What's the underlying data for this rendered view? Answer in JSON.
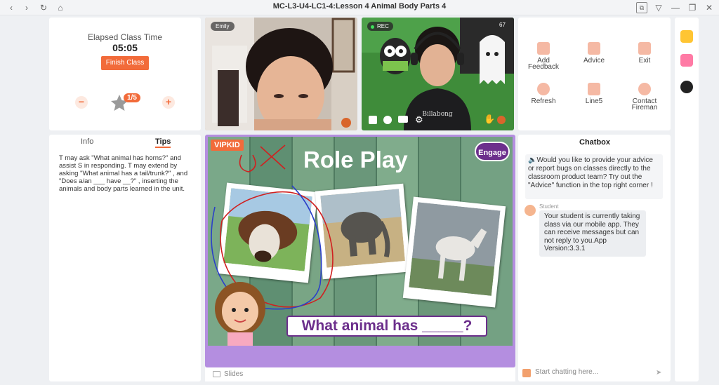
{
  "window": {
    "title": "MC-L3-U4-LC1-4:Lesson 4 Animal Body Parts 4"
  },
  "class_control": {
    "elapsed_label": "Elapsed Class Time",
    "elapsed_value": "05:05",
    "finish_label": "Finish Class",
    "minus_symbol": "−",
    "plus_symbol": "+",
    "star_count": "1/5"
  },
  "videos": {
    "student_name": "Emily",
    "rec_label": "REC",
    "signal_value": "67"
  },
  "tools": [
    {
      "label": "Add Feedback",
      "icon": "add-feedback-icon"
    },
    {
      "label": "Advice",
      "icon": "advice-icon"
    },
    {
      "label": "Exit",
      "icon": "exit-icon"
    },
    {
      "label": "Refresh",
      "icon": "refresh-icon"
    },
    {
      "label": "Line5",
      "icon": "line-switch-icon"
    },
    {
      "label": "Contact Fireman",
      "icon": "contact-fireman-icon"
    }
  ],
  "info_panel": {
    "tab_info": "Info",
    "tab_tips": "Tips",
    "tips_text": "T may ask \"What animal has horns?\" and assist S in responding. T may extend by asking \"What animal has a tail/trunk?\" , and \"Does a/an ___ have __?\" , inserting the animals and body parts learned in the unit."
  },
  "slide": {
    "brand": "VIPKID",
    "engage_label": "Engage",
    "title": "Role Play",
    "question": "What animal has _____?"
  },
  "slides_footer": {
    "label": "Slides"
  },
  "chat": {
    "title": "Chatbox",
    "notice": "Would you like to provide your advice or report bugs on classes directly to the classroom product team? Try out the \"Advice\" function in the top right corner !",
    "student_label": "Student",
    "student_message": "Your student is currently taking class via our mobile app. They can receive messages but can not reply to you.App Version:3.3.1",
    "input_placeholder": "Start chatting here..."
  },
  "colors": {
    "accent": "#f26b3a",
    "purple": "#7a3fa0",
    "slide_border": "#b48ee0"
  }
}
